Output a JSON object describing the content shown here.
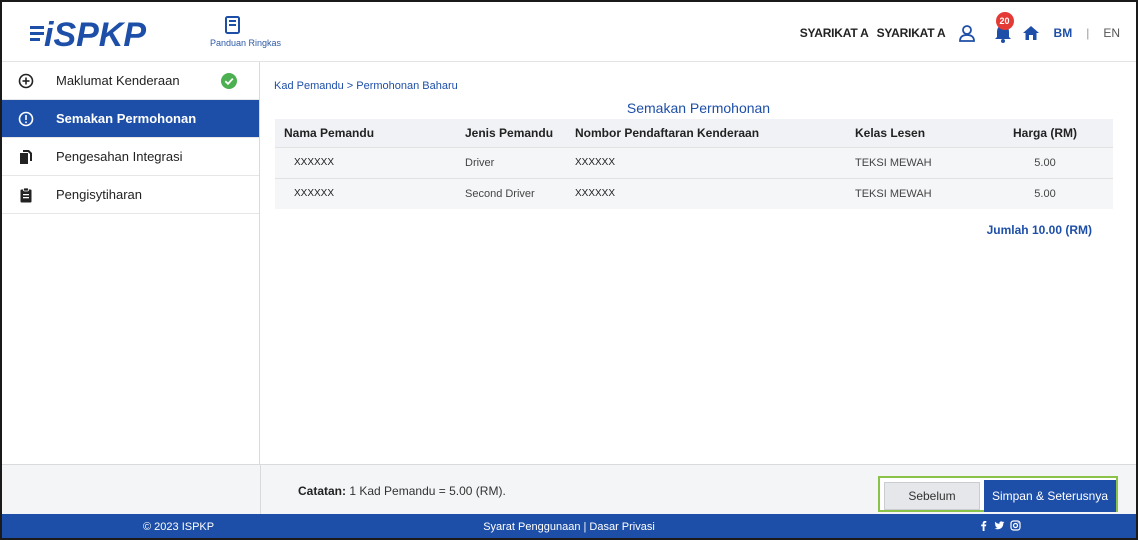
{
  "header": {
    "logo_text": "iSPKP",
    "guide_label": "Panduan Ringkas",
    "company_1": "SYARIKAT A",
    "company_2": "SYARIKAT A",
    "notification_count": "20",
    "lang_bm": "BM",
    "lang_sep": "|",
    "lang_en": "EN"
  },
  "sidebar": {
    "items": [
      {
        "label": "Maklumat Kenderaan",
        "icon": "plus-circle-icon",
        "completed": true
      },
      {
        "label": "Semakan Permohonan",
        "icon": "info-circle-icon",
        "active": true
      },
      {
        "label": "Pengesahan Integrasi",
        "icon": "documents-icon"
      },
      {
        "label": "Pengisytiharan",
        "icon": "clipboard-icon"
      }
    ]
  },
  "main": {
    "breadcrumb": "Kad Pemandu > Permohonan Baharu",
    "title": "Semakan Permohonan",
    "columns": [
      "Nama Pemandu",
      "Jenis Pemandu",
      "Nombor Pendaftaran Kenderaan",
      "Kelas Lesen",
      "Harga (RM)"
    ],
    "rows": [
      {
        "nama": "XXXXXX",
        "jenis": "Driver",
        "nombor": "XXXXXX",
        "kelas": "TEKSI MEWAH",
        "harga": "5.00"
      },
      {
        "nama": "XXXXXX",
        "jenis": "Second Driver",
        "nombor": "XXXXXX",
        "kelas": "TEKSI MEWAH",
        "harga": "5.00"
      }
    ],
    "total": "Jumlah 10.00 (RM)"
  },
  "bottom": {
    "note_label": "Catatan:",
    "note_text": "1 Kad Pemandu = 5.00 (RM).",
    "prev_label": "Sebelum",
    "next_label": "Simpan & Seterusnya"
  },
  "footer": {
    "copyright": "© 2023 ISPKP",
    "links": "Syarat Penggunaan | Dasar Privasi",
    "social": [
      "facebook-icon",
      "twitter-icon",
      "instagram-icon"
    ]
  },
  "colors": {
    "primary": "#1e4fa8",
    "accent_green": "#8bc34a",
    "check_green": "#4caf50",
    "badge_red": "#e53935"
  }
}
